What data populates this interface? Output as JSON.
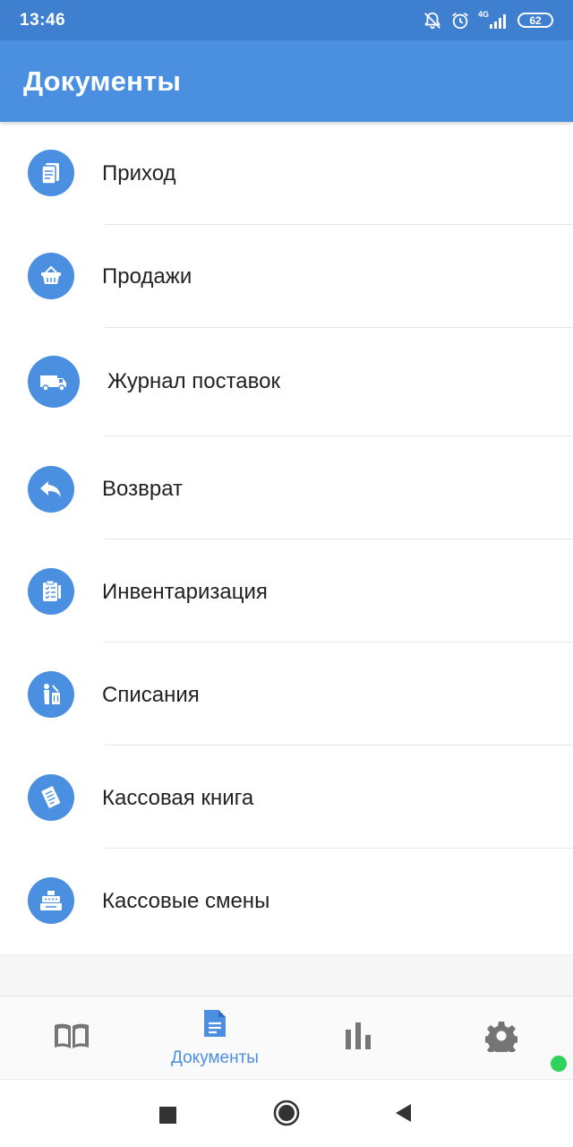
{
  "status_bar": {
    "time": "13:46",
    "network": "4G",
    "battery": "62"
  },
  "app_bar": {
    "title": "Документы"
  },
  "documents": {
    "items": [
      {
        "label": "Приход",
        "icon": "clipboard-docs-icon"
      },
      {
        "label": "Продажи",
        "icon": "basket-icon"
      },
      {
        "label": "Журнал поставок",
        "icon": "truck-icon"
      },
      {
        "label": "Возврат",
        "icon": "reply-arrow-icon"
      },
      {
        "label": "Инвентаризация",
        "icon": "checklist-icon"
      },
      {
        "label": "Списания",
        "icon": "trash-disposal-icon"
      },
      {
        "label": "Кассовая книга",
        "icon": "ledger-icon"
      },
      {
        "label": "Кассовые смены",
        "icon": "cash-register-icon"
      }
    ]
  },
  "bottom_nav": {
    "tabs": [
      {
        "icon": "book-icon",
        "label": ""
      },
      {
        "icon": "document-icon",
        "label": "Документы",
        "active": true
      },
      {
        "icon": "bar-chart-icon",
        "label": ""
      },
      {
        "icon": "gear-icon",
        "label": ""
      }
    ]
  },
  "colors": {
    "accent": "#4a8fe0",
    "status_bar": "#3f7fcf",
    "inactive_icon": "#757575",
    "online_indicator": "#2ed35a"
  }
}
